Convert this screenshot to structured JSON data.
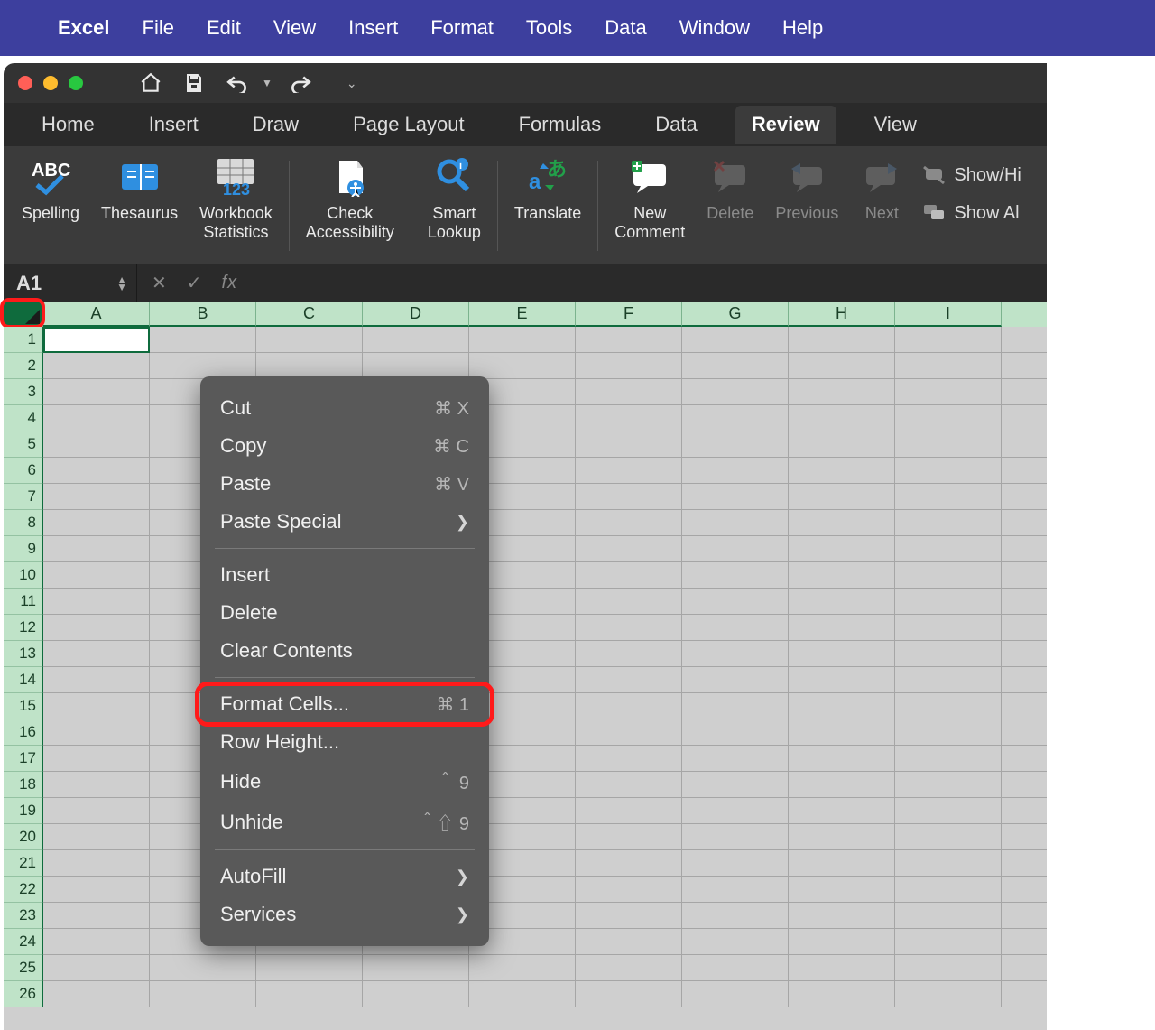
{
  "macbar": {
    "app": "Excel",
    "items": [
      "File",
      "Edit",
      "View",
      "Insert",
      "Format",
      "Tools",
      "Data",
      "Window",
      "Help"
    ]
  },
  "ribbon_tabs": [
    "Home",
    "Insert",
    "Draw",
    "Page Layout",
    "Formulas",
    "Data",
    "Review",
    "View"
  ],
  "ribbon_active": "Review",
  "ribbon_buttons": {
    "spelling": "Spelling",
    "thesaurus": "Thesaurus",
    "wbstats": "Workbook\nStatistics",
    "checkacc": "Check\nAccessibility",
    "smartlookup": "Smart\nLookup",
    "translate": "Translate",
    "newcomment": "New\nComment",
    "delete": "Delete",
    "previous": "Previous",
    "next": "Next",
    "showhide": "Show/Hi",
    "showall": "Show Al"
  },
  "formula_bar": {
    "namebox": "A1",
    "cancel_glyph": "✕",
    "accept_glyph": "✓",
    "fx_label": "fx"
  },
  "columns": [
    "A",
    "B",
    "C",
    "D",
    "E",
    "F",
    "G",
    "H",
    "I"
  ],
  "rows": [
    "1",
    "2",
    "3",
    "4",
    "5",
    "6",
    "7",
    "8",
    "9",
    "10",
    "11",
    "12",
    "13",
    "14",
    "15",
    "16",
    "17",
    "18",
    "19",
    "20",
    "21",
    "22",
    "23",
    "24",
    "25",
    "26"
  ],
  "context_menu": {
    "cut": "Cut",
    "cut_k": "⌘ X",
    "copy": "Copy",
    "copy_k": "⌘ C",
    "paste": "Paste",
    "paste_k": "⌘ V",
    "paste_special": "Paste Special",
    "insert": "Insert",
    "delete": "Delete",
    "clear": "Clear Contents",
    "format_cells": "Format Cells...",
    "format_cells_k": "⌘ 1",
    "row_height": "Row Height...",
    "hide": "Hide",
    "hide_k": "＾ 9",
    "unhide": "Unhide",
    "unhide_k": "＾⇧ 9",
    "autofill": "AutoFill",
    "services": "Services"
  }
}
